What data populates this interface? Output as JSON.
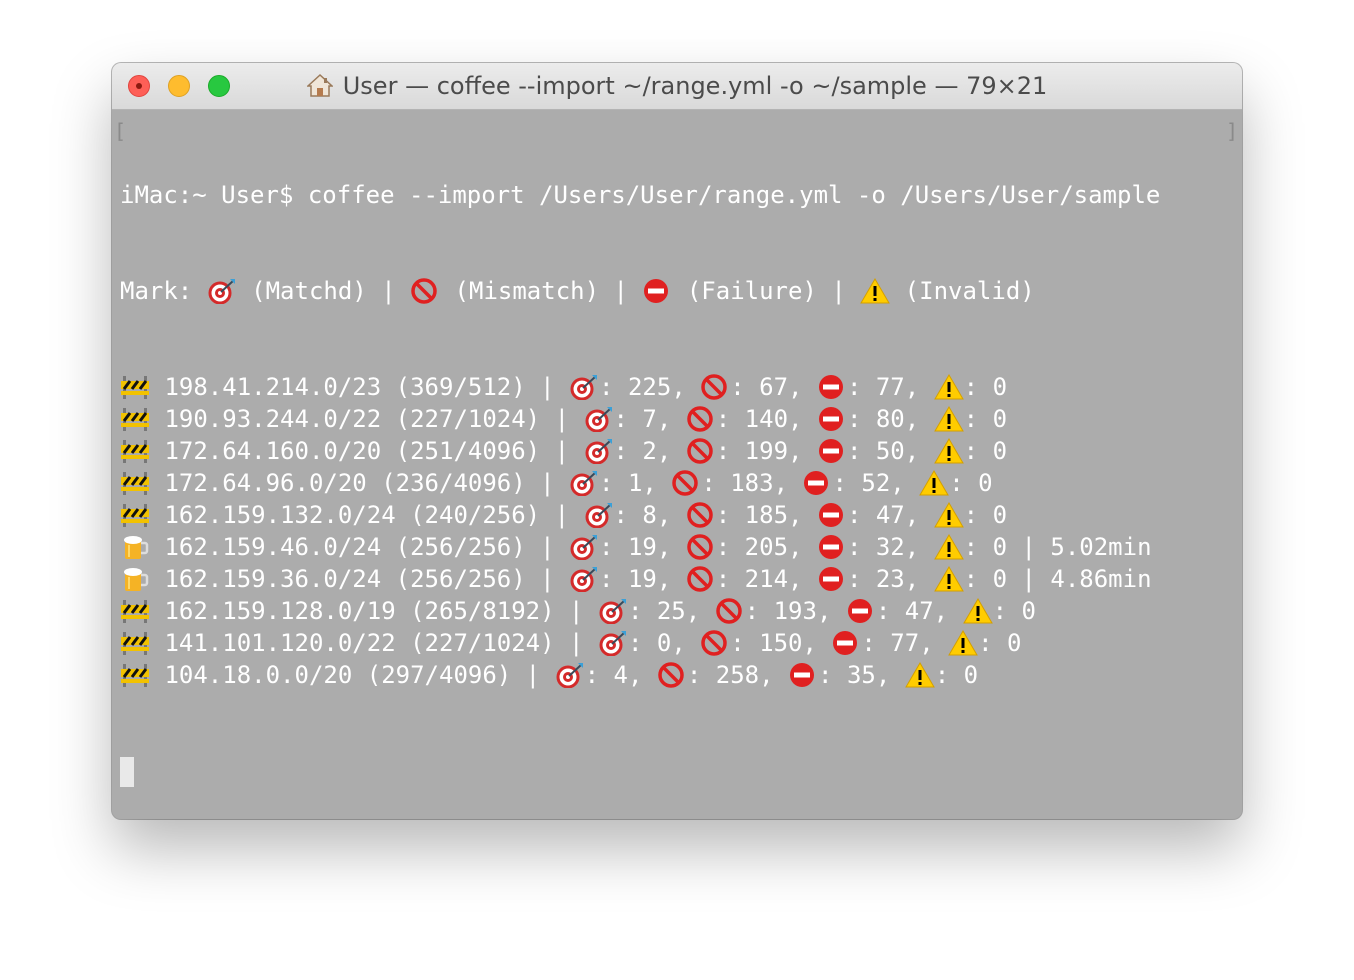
{
  "window": {
    "title": "User — coffee --import ~/range.yml -o ~/sample — 79×21",
    "title_icon": "home-icon"
  },
  "colors": {
    "terminal_bg": "#acacac",
    "terminal_text": "#ffffff",
    "close": "#fe5f57",
    "minimize": "#febc2e",
    "zoom": "#28c840"
  },
  "terminal": {
    "prompt": "iMac:~ User$ ",
    "command": "coffee --import /Users/User/range.yml -o /Users/User/sample",
    "legend": {
      "prefix": "Mark: ",
      "matched": " (Matchd) | ",
      "mismatch": " (Mismatch) | ",
      "failure": " (Failure) | ",
      "invalid": " (Invalid)"
    },
    "rows": [
      {
        "status": "barrier-icon",
        "range": "198.41.214.0/23 (369/512)",
        "matched": "225",
        "mismatch": "67",
        "failure": "77",
        "invalid": "0",
        "time": ""
      },
      {
        "status": "barrier-icon",
        "range": "190.93.244.0/22 (227/1024)",
        "matched": "7",
        "mismatch": "140",
        "failure": "80",
        "invalid": "0",
        "time": ""
      },
      {
        "status": "barrier-icon",
        "range": "172.64.160.0/20 (251/4096)",
        "matched": "2",
        "mismatch": "199",
        "failure": "50",
        "invalid": "0",
        "time": ""
      },
      {
        "status": "barrier-icon",
        "range": "172.64.96.0/20 (236/4096)",
        "matched": "1",
        "mismatch": "183",
        "failure": "52",
        "invalid": "0",
        "time": ""
      },
      {
        "status": "barrier-icon",
        "range": "162.159.132.0/24 (240/256)",
        "matched": "8",
        "mismatch": "185",
        "failure": "47",
        "invalid": "0",
        "time": ""
      },
      {
        "status": "beer-mug-icon",
        "range": "162.159.46.0/24 (256/256)",
        "matched": "19",
        "mismatch": "205",
        "failure": "32",
        "invalid": "0",
        "time": "5.02min"
      },
      {
        "status": "beer-mug-icon",
        "range": "162.159.36.0/24 (256/256)",
        "matched": "19",
        "mismatch": "214",
        "failure": "23",
        "invalid": "0",
        "time": "4.86min"
      },
      {
        "status": "barrier-icon",
        "range": "162.159.128.0/19 (265/8192)",
        "matched": "25",
        "mismatch": "193",
        "failure": "47",
        "invalid": "0",
        "time": ""
      },
      {
        "status": "barrier-icon",
        "range": "141.101.120.0/22 (227/1024)",
        "matched": "0",
        "mismatch": "150",
        "failure": "77",
        "invalid": "0",
        "time": ""
      },
      {
        "status": "barrier-icon",
        "range": "104.18.0.0/20 (297/4096)",
        "matched": "4",
        "mismatch": "258",
        "failure": "35",
        "invalid": "0",
        "time": ""
      }
    ]
  }
}
